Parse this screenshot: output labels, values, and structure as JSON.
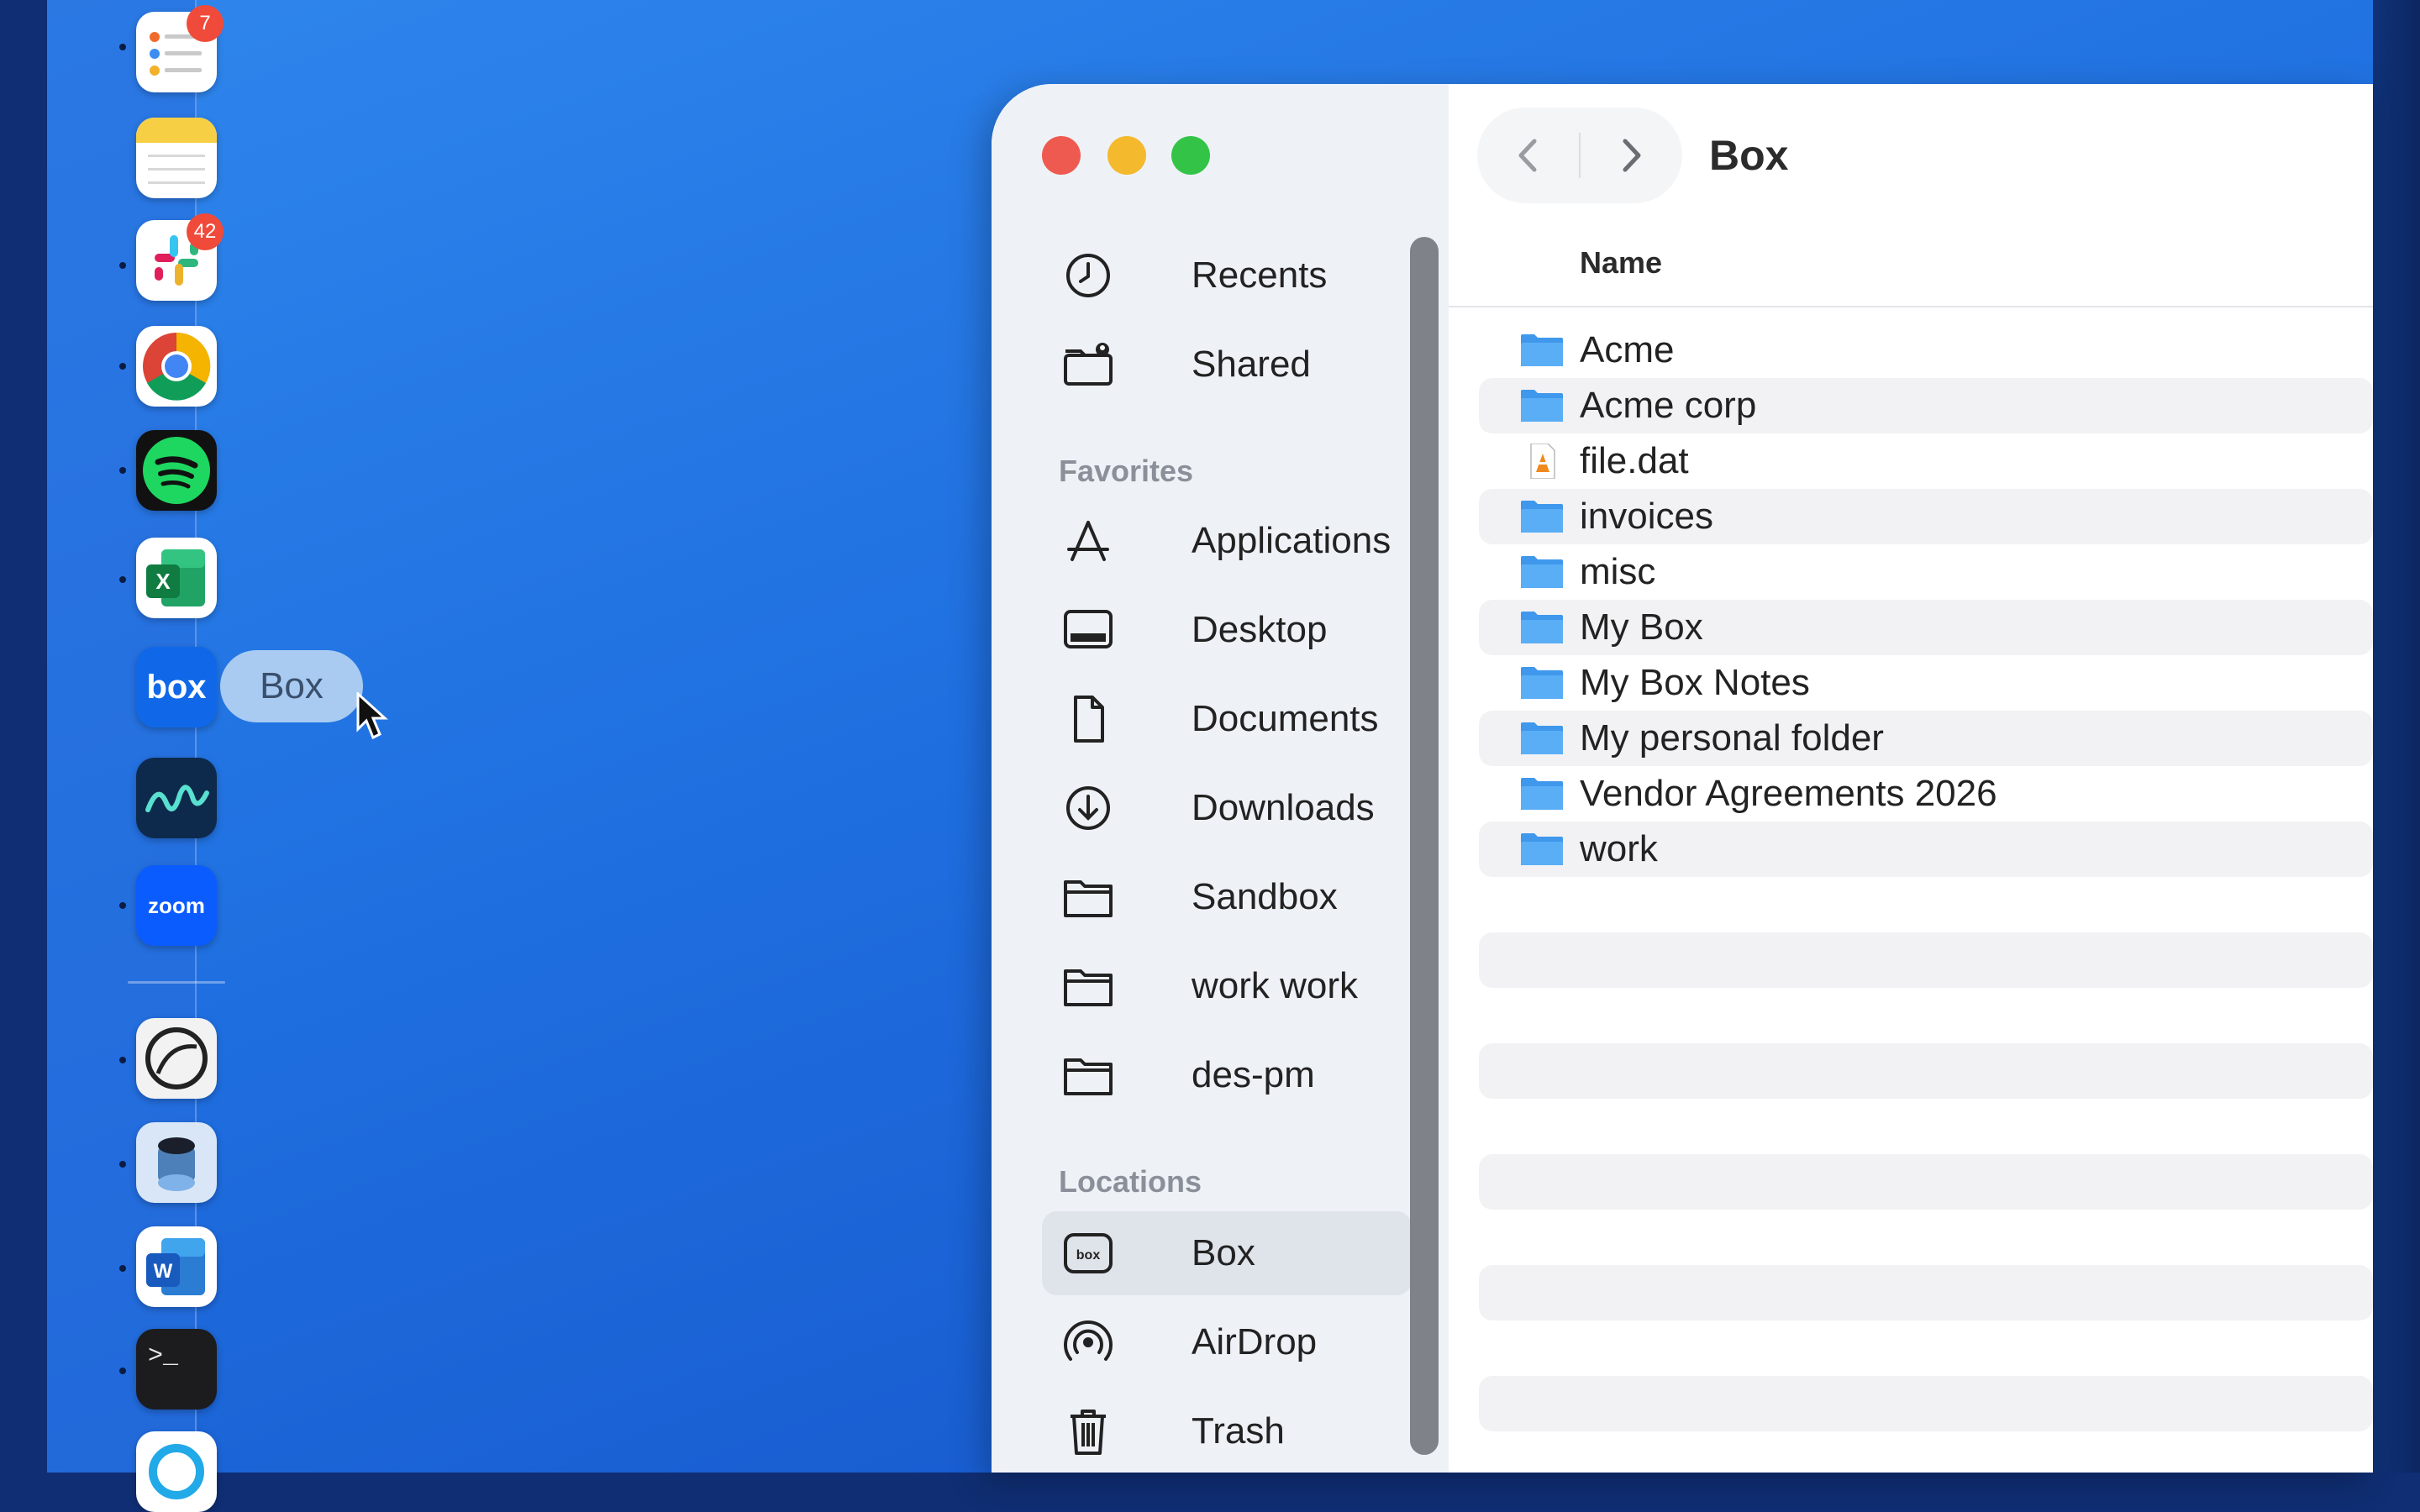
{
  "dock": {
    "apps": [
      {
        "name": "Reminders",
        "icon": "reminders-icon",
        "badge": "7"
      },
      {
        "name": "Notes",
        "icon": "notes-icon",
        "badge": ""
      },
      {
        "name": "Slack",
        "icon": "slack-icon",
        "badge": "42"
      },
      {
        "name": "Google Chrome",
        "icon": "chrome-icon",
        "badge": ""
      },
      {
        "name": "Spotify",
        "icon": "spotify-icon",
        "badge": ""
      },
      {
        "name": "Excel",
        "icon": "excel-icon",
        "badge": ""
      },
      {
        "name": "Box",
        "icon": "box-app-icon",
        "badge": "",
        "label": "box"
      },
      {
        "name": "Freeform",
        "icon": "freeform-icon",
        "badge": ""
      },
      {
        "name": "Zoom",
        "icon": "zoom-icon",
        "badge": "",
        "label": "zoom"
      },
      {
        "name": "Activity Monitor",
        "icon": "circle-app-icon",
        "badge": ""
      },
      {
        "name": "Storage app",
        "icon": "cylinder-app-icon",
        "badge": ""
      },
      {
        "name": "Word",
        "icon": "word-icon",
        "badge": ""
      },
      {
        "name": "Terminal",
        "icon": "terminal-icon",
        "badge": "",
        "label": ">_"
      },
      {
        "name": "Webex",
        "icon": "webex-icon",
        "badge": ""
      }
    ],
    "tooltip": "Box"
  },
  "window": {
    "title": "Box",
    "traffic_lights": {
      "close": "#ee5a4f",
      "minimize": "#f4b92d",
      "maximize": "#33c447"
    },
    "sidebar": {
      "top_items": [
        {
          "label": "Recents",
          "icon": "clock-icon"
        },
        {
          "label": "Shared",
          "icon": "shared-folder-icon"
        }
      ],
      "favorites_header": "Favorites",
      "favorites": [
        {
          "label": "Applications",
          "icon": "applications-icon"
        },
        {
          "label": "Desktop",
          "icon": "desktop-icon"
        },
        {
          "label": "Documents",
          "icon": "document-icon"
        },
        {
          "label": "Downloads",
          "icon": "download-icon"
        },
        {
          "label": "Sandbox",
          "icon": "folder-icon"
        },
        {
          "label": "work work",
          "icon": "folder-icon"
        },
        {
          "label": "des-pm",
          "icon": "folder-icon"
        }
      ],
      "locations_header": "Locations",
      "locations": [
        {
          "label": "Box",
          "icon": "box-location-icon",
          "selected": true
        },
        {
          "label": "AirDrop",
          "icon": "airdrop-icon",
          "selected": false
        },
        {
          "label": "Trash",
          "icon": "trash-icon",
          "selected": false
        }
      ]
    },
    "column_header": "Name",
    "files": [
      {
        "name": "Acme",
        "type": "folder"
      },
      {
        "name": "Acme corp",
        "type": "folder"
      },
      {
        "name": "file.dat",
        "type": "file"
      },
      {
        "name": "invoices",
        "type": "folder"
      },
      {
        "name": "misc",
        "type": "folder"
      },
      {
        "name": "My Box",
        "type": "folder"
      },
      {
        "name": "My Box Notes",
        "type": "folder"
      },
      {
        "name": "My personal folder",
        "type": "folder"
      },
      {
        "name": "Vendor Agreements 2026",
        "type": "folder"
      },
      {
        "name": "work",
        "type": "folder"
      }
    ]
  },
  "colors": {
    "accent_folder": "#5aaef5",
    "selection": "#dfe3ea"
  }
}
